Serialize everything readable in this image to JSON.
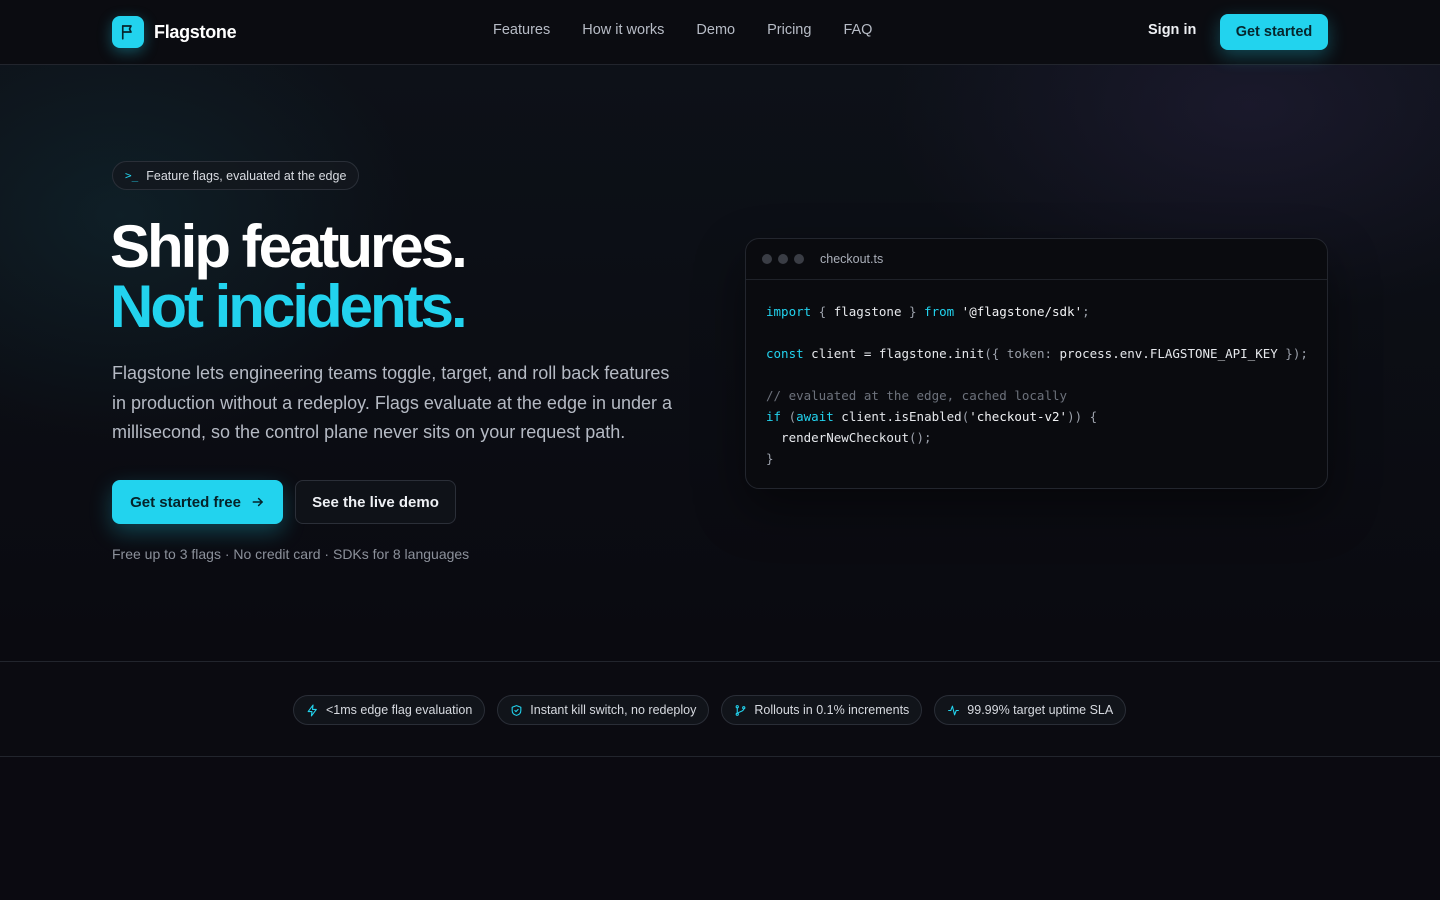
{
  "nav": {
    "brand": "Flagstone",
    "links": [
      "Features",
      "How it works",
      "Demo",
      "Pricing",
      "FAQ"
    ],
    "sign_in": "Sign in",
    "cta": "Get started"
  },
  "hero": {
    "pill": "Feature flags, evaluated at the edge",
    "headline_1": "Ship features.",
    "headline_2": "Not incidents.",
    "lede": "Flagstone lets engineering teams toggle, target, and roll back features in production without a redeploy. Flags evaluate at the edge in under a millisecond, so the control plane never sits on your request path.",
    "primary_cta": "Get started free",
    "secondary_cta": "See the live demo",
    "fineprint": "Free up to 3 flags · No credit card · SDKs for 8 languages"
  },
  "code": {
    "filename": "checkout.ts",
    "l1_kw1": "import",
    "l1_b1": " { ",
    "l1_id": "flagstone",
    "l1_b2": " } ",
    "l1_kw2": "from",
    "l1_str": " '@flagstone/sdk'",
    "l1_end": ";",
    "l2_kw": "const",
    "l2_id": " client = flagstone.init",
    "l2_p1": "({ ",
    "l2_key": "token:",
    "l2_val": " process.env.FLAGSTONE_API_KEY",
    "l2_p2": " });",
    "l3_cmt": "// evaluated at the edge, cached locally",
    "l4_kw1": "if",
    "l4_p1": " (",
    "l4_kw2": "await",
    "l4_id": " client.isEnabled",
    "l4_p2": "(",
    "l4_str": "'checkout-v2'",
    "l4_p3": ")) {",
    "l5_id": "  renderNewCheckout",
    "l5_p": "();",
    "l6_p": "}"
  },
  "features": [
    {
      "label": "<1ms edge flag evaluation",
      "icon": "bolt-icon"
    },
    {
      "label": "Instant kill switch, no redeploy",
      "icon": "shield-check-icon"
    },
    {
      "label": "Rollouts in 0.1% increments",
      "icon": "git-branch-icon"
    },
    {
      "label": "99.99% target uptime SLA",
      "icon": "activity-icon"
    }
  ],
  "colors": {
    "accent": "#22d3ee",
    "background": "#0a0a10"
  }
}
